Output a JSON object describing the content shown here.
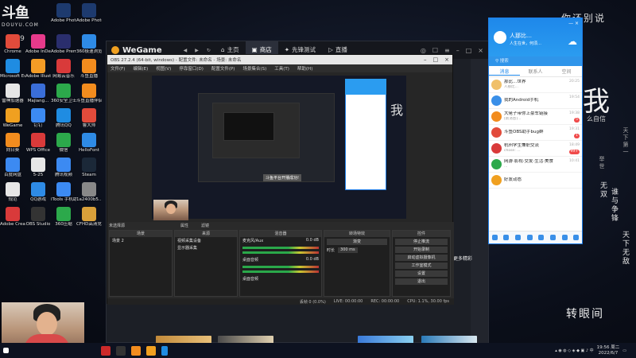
{
  "watermark": {
    "logo_big": "斗鱼",
    "logo_small": "DOUYU.COM",
    "room_number": "4859"
  },
  "desktop_icons": [
    {
      "label": "Adobe Photosh...",
      "color": "#1d3a6e"
    },
    {
      "label": "Adobe Photosh...",
      "color": "#1d3a6e"
    },
    {
      "label": "Chrome",
      "color": "#e24b3b"
    },
    {
      "label": "Adobe InDesi...",
      "color": "#e73a8b"
    },
    {
      "label": "Adobe Premie...",
      "color": "#2a2e6d"
    },
    {
      "label": "360极速浏览器",
      "color": "#2e8be6"
    },
    {
      "label": "Microsoft Edge",
      "color": "#1f8ce2"
    },
    {
      "label": "Adobe Illustrat...",
      "color": "#f39c26"
    },
    {
      "label": "网易云音乐",
      "color": "#d93a3a"
    },
    {
      "label": "斗鱼直播",
      "color": "#f28c1e"
    },
    {
      "label": "雷神加速器",
      "color": "#e6e6e6"
    },
    {
      "label": "Majiang...",
      "color": "#3a6ed9"
    },
    {
      "label": "360安全卫士",
      "color": "#2ca94b"
    },
    {
      "label": "斗鱼直播伴侣",
      "color": "#f28c1e"
    },
    {
      "label": "WeGame",
      "color": "#f0a020"
    },
    {
      "label": "钉钉",
      "color": "#3c8af2"
    },
    {
      "label": "腾讯QQ",
      "color": "#1f8ce2"
    },
    {
      "label": "鲁大师",
      "color": "#e24b3b"
    },
    {
      "label": "向日葵",
      "color": "#f28c1e"
    },
    {
      "label": "WPS Office",
      "color": "#d93a3a"
    },
    {
      "label": "微信",
      "color": "#2ca94b"
    },
    {
      "label": "HelloFont",
      "color": "#2e8be6"
    },
    {
      "label": "百度网盘",
      "color": "#3c8af2"
    },
    {
      "label": "5-25",
      "color": "#e6e6e6"
    },
    {
      "label": "腾讯视频",
      "color": "#3c8af2"
    },
    {
      "label": "Steam",
      "color": "#1b2838"
    },
    {
      "label": "规范",
      "color": "#e6e6e6"
    },
    {
      "label": "QQ游戏",
      "color": "#2e8be6"
    },
    {
      "label": "iTools 手机助手",
      "color": "#3c8af2"
    },
    {
      "label": "1a2400b5...",
      "color": "#888888"
    },
    {
      "label": "Adobe Creati...",
      "color": "#d93a3a"
    },
    {
      "label": "OBS Studio",
      "color": "#333333"
    },
    {
      "label": "360压缩",
      "color": "#2ca94b"
    },
    {
      "label": "CFHD高清竞技大区",
      "color": "#d9a03a"
    }
  ],
  "wegame": {
    "logo": "WeGame",
    "tabs": [
      {
        "label": "主页",
        "active": false
      },
      {
        "label": "商店",
        "active": true
      },
      {
        "label": "先锋测试",
        "active": false
      },
      {
        "label": "直播",
        "active": false
      }
    ],
    "more_label": "更多精彩"
  },
  "obs": {
    "title": "OBS 27.2.4 (64-bit, windows) - 配置文件: 未命名 - 场景: 未命名",
    "menu": [
      "文件(F)",
      "编辑(E)",
      "视图(V)",
      "停靠窗口(D)",
      "配置文件(P)",
      "场景集合(S)",
      "工具(T)",
      "帮助(H)"
    ],
    "no_source_label": "未选择源",
    "properties_label": "属性",
    "filters_label": "滤镜",
    "panels": {
      "scenes": {
        "header": "场景",
        "items": [
          "场景 2"
        ]
      },
      "sources": {
        "header": "来源",
        "items": [
          "视频采集设备",
          "显示器采集"
        ]
      },
      "mixer": {
        "header": "混音器",
        "rows": [
          "麦克风/Aux",
          "桌面音频"
        ],
        "db1": "0.0 dB",
        "db2": "0.0 dB",
        "source_label": "桌面音频"
      },
      "transitions": {
        "header": "转场特效",
        "type": "渐变",
        "duration_label": "时长",
        "duration_value": "300 ms"
      },
      "controls": {
        "header": "控件",
        "buttons": [
          "停止推流",
          "开始录制",
          "启动虚拟摄像机",
          "工作室模式",
          "设置",
          "退出"
        ]
      }
    },
    "status": [
      "丢帧 0 (0.0%)",
      "LIVE: 00:00:00",
      "REC: 00:00:00",
      "CPU: 1.1%, 30.00 fps"
    ],
    "nested_caption": "斗鱼平台开播成功!"
  },
  "qq": {
    "nickname": "人那比…",
    "signature": "人生在世，何须…",
    "search_placeholder": "搜索",
    "tabs": [
      {
        "label": "消息",
        "active": true
      },
      {
        "label": "联系人",
        "active": false
      },
      {
        "label": "空间",
        "active": false
      }
    ],
    "chats": [
      {
        "name": "那比…世界",
        "msg": "人那比…",
        "time": "20:25",
        "color": "#f0c06a",
        "badge": ""
      },
      {
        "name": "我的Android手机",
        "msg": "",
        "time": "19:54",
        "color": "#3a8fe8",
        "badge": ""
      },
      {
        "name": "大佬子带你上豪车链接",
        "msg": "[新消息]…",
        "time": "19:38",
        "color": "#f28c1e",
        "badge": "5"
      },
      {
        "name": "斗鱼OBS助手bug群",
        "msg": "",
        "time": "19:31",
        "color": "#e24b3b",
        "badge": "1"
      },
      {
        "name": "杭州学生兼职交流",
        "msg": "chose: …",
        "time": "18:49",
        "color": "#d93a3a",
        "badge": "99+"
      },
      {
        "name": "网游·影视·交友·生活·美食",
        "msg": "…",
        "time": "10:41",
        "color": "#2ca94b",
        "badge": ""
      },
      {
        "name": "好友动态",
        "msg": "",
        "time": "",
        "color": "#f0a020",
        "badge": ""
      }
    ]
  },
  "wallpaper": {
    "top_text": "你还别说",
    "big_char": "我",
    "sub_text": "么自信",
    "vertical_1": "无双",
    "vertical_2": "谁与争锋",
    "vertical_3": "天下无敌",
    "small_v1": "天下第一",
    "small_v2": "举世",
    "bottom_text": "转眼间"
  },
  "taskbar": {
    "time": "19:56",
    "date": "2022/6/7",
    "weekday": "周二"
  }
}
